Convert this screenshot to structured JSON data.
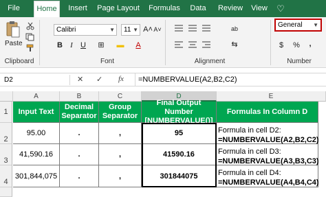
{
  "menu": {
    "tabs": [
      "File",
      "Home",
      "Insert",
      "Page Layout",
      "Formulas",
      "Data",
      "Review",
      "View"
    ],
    "active": "Home",
    "more_label": "♡"
  },
  "ribbon": {
    "paste_label": "Paste",
    "font_name": "Calibri",
    "font_size": "11",
    "number_format": "General",
    "groups": {
      "clipboard": "Clipboard",
      "font": "Font",
      "alignment": "Alignment",
      "number": "Number"
    },
    "font_buttons": {
      "grow": "A˄",
      "shrink": "A˅",
      "bold": "B",
      "italic": "I",
      "underline": "U",
      "border": "⊞",
      "fill": "▬",
      "color": "A"
    },
    "number_buttons": {
      "currency": "$",
      "percent": "%",
      "comma": ","
    },
    "alignment_glyphs": "≡",
    "wrap": "ab",
    "merge": "⇆"
  },
  "formula_bar": {
    "name_box": "D2",
    "cancel": "✕",
    "enter": "✓",
    "fx": "fx",
    "formula": "=NUMBERVALUE(A2,B2,C2)"
  },
  "sheet": {
    "columns": [
      "A",
      "B",
      "C",
      "D",
      "E"
    ],
    "selected_column": "D",
    "row_numbers": [
      "1",
      "2",
      "3",
      "4"
    ],
    "headers": [
      "Input Text",
      "Decimal Separator",
      "Group Separator",
      "Final Output Number [NUMBERVALUE()]",
      "Formulas In Column D"
    ],
    "rows": [
      {
        "input": "95.00",
        "decimal": ".",
        "group": ",",
        "output": "95",
        "formula_title": "Formula in cell D2:",
        "formula": "=NUMBERVALUE(A2,B2,C2)"
      },
      {
        "input": "41,590.16",
        "decimal": ".",
        "group": ",",
        "output": "41590.16",
        "formula_title": "Formula in cell D3:",
        "formula": "=NUMBERVALUE(A3,B3,C3)"
      },
      {
        "input": "301,844,075",
        "decimal": ".",
        "group": ",",
        "output": "301844075",
        "formula_title": "Formula in cell D4:",
        "formula": "=NUMBERVALUE(A4,B4,C4)"
      }
    ]
  },
  "colors": {
    "ribbon_green": "#217346",
    "header_green": "#00a651",
    "highlight_red": "#c00000"
  }
}
